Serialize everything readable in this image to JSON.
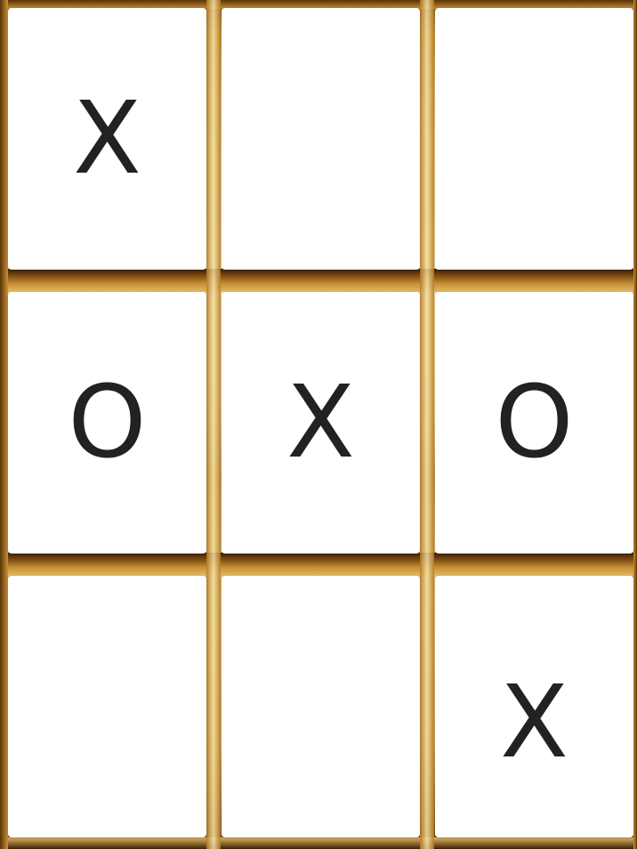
{
  "board": {
    "cells": [
      {
        "mark": "X"
      },
      {
        "mark": ""
      },
      {
        "mark": ""
      },
      {
        "mark": "O"
      },
      {
        "mark": "X"
      },
      {
        "mark": "O"
      },
      {
        "mark": ""
      },
      {
        "mark": ""
      },
      {
        "mark": "X"
      }
    ],
    "colors": {
      "mark": "#222222",
      "cell": "#ffffff",
      "wood_light": "#f1d48c",
      "wood_dark": "#6b3d0c"
    }
  }
}
